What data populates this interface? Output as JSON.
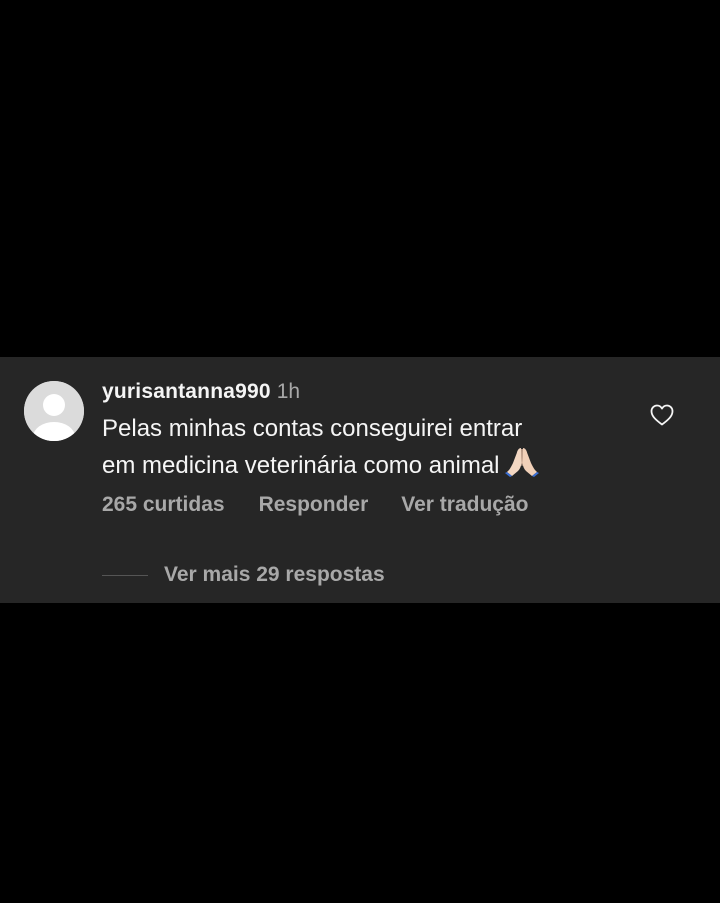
{
  "comment": {
    "username": "yurisantanna990",
    "timestamp": "1h",
    "text": "Pelas minhas contas conseguirei entrar\nem medicina veterinária como animal",
    "emoji": "folded-hands-emoji",
    "likes_label": "265 curtidas",
    "reply_label": "Responder",
    "translate_label": "Ver tradução",
    "more_replies_label": "Ver mais 29 respostas",
    "like_icon": "heart-outline-icon",
    "avatar": "default-avatar-icon"
  },
  "colors": {
    "background": "#000000",
    "panel": "#262626",
    "primary_text": "#f5f5f5",
    "secondary_text": "#a8a8a8"
  }
}
